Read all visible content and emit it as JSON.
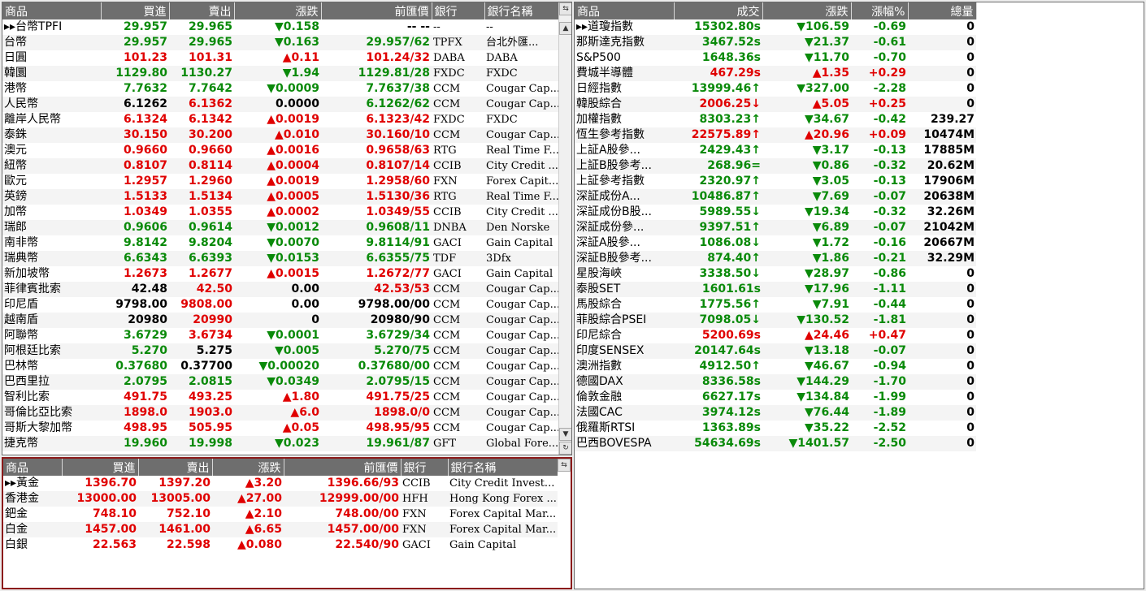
{
  "fx": {
    "headers": [
      "商品",
      "買進",
      "賣出",
      "漲跌",
      "前匯價",
      "銀行",
      "銀行名稱"
    ],
    "rows": [
      [
        "▸▸台幣TPFI",
        "29.957",
        "29.965",
        "▼0.158",
        "-- --",
        "--",
        "--",
        "g",
        "g",
        "g",
        "k"
      ],
      [
        "台幣",
        "29.957",
        "29.965",
        "▼0.163",
        "29.957/62",
        "TPFX",
        "台北外匯...",
        "g",
        "g",
        "g",
        "g"
      ],
      [
        "日圓",
        "101.23",
        "101.31",
        "▲0.11",
        "101.24/32",
        "DABA",
        "DABA",
        "rd",
        "rd",
        "rd",
        "rd"
      ],
      [
        "韓圜",
        "1129.80",
        "1130.27",
        "▼1.94",
        "1129.81/28",
        "FXDC",
        "FXDC",
        "g",
        "g",
        "g",
        "g"
      ],
      [
        "港幣",
        "7.7632",
        "7.7642",
        "▼0.0009",
        "7.7637/38",
        "CCM",
        "Cougar Cap...",
        "g",
        "g",
        "g",
        "g"
      ],
      [
        "人民幣",
        "6.1262",
        "6.1362",
        "0.0000",
        "6.1262/62",
        "CCM",
        "Cougar Cap...",
        "k",
        "rd",
        "k",
        "g"
      ],
      [
        "離岸人民幣",
        "6.1324",
        "6.1342",
        "▲0.0019",
        "6.1323/42",
        "FXDC",
        "FXDC",
        "rd",
        "rd",
        "rd",
        "rd"
      ],
      [
        "泰銖",
        "30.150",
        "30.200",
        "▲0.010",
        "30.160/10",
        "CCM",
        "Cougar Cap...",
        "rd",
        "rd",
        "rd",
        "rd"
      ],
      [
        "澳元",
        "0.9660",
        "0.9660",
        "▲0.0016",
        "0.9658/63",
        "RTG",
        "Real Time F...",
        "rd",
        "rd",
        "rd",
        "rd"
      ],
      [
        "紐幣",
        "0.8107",
        "0.8114",
        "▲0.0004",
        "0.8107/14",
        "CCIB",
        "City Credit ...",
        "rd",
        "rd",
        "rd",
        "rd"
      ],
      [
        "歐元",
        "1.2957",
        "1.2960",
        "▲0.0019",
        "1.2958/60",
        "FXN",
        "Forex Capit...",
        "rd",
        "rd",
        "rd",
        "rd"
      ],
      [
        "英鎊",
        "1.5133",
        "1.5134",
        "▲0.0005",
        "1.5130/36",
        "RTG",
        "Real Time F...",
        "rd",
        "rd",
        "rd",
        "rd"
      ],
      [
        "加幣",
        "1.0349",
        "1.0355",
        "▲0.0002",
        "1.0349/55",
        "CCIB",
        "City Credit ...",
        "rd",
        "rd",
        "rd",
        "rd"
      ],
      [
        "瑞郎",
        "0.9606",
        "0.9614",
        "▼0.0012",
        "0.9608/11",
        "DNBA",
        "Den Norske",
        "g",
        "g",
        "g",
        "g"
      ],
      [
        "南非幣",
        "9.8142",
        "9.8204",
        "▼0.0070",
        "9.8114/91",
        "GACI",
        "Gain Capital",
        "g",
        "g",
        "g",
        "g"
      ],
      [
        "瑞典幣",
        "6.6343",
        "6.6393",
        "▼0.0153",
        "6.6355/75",
        "TDF",
        "3Dfx",
        "g",
        "g",
        "g",
        "g"
      ],
      [
        "新加坡幣",
        "1.2673",
        "1.2677",
        "▲0.0015",
        "1.2672/77",
        "GACI",
        "Gain Capital",
        "rd",
        "rd",
        "rd",
        "rd"
      ],
      [
        "菲律賓批索",
        "42.48",
        "42.50",
        "0.00",
        "42.53/53",
        "CCM",
        "Cougar Cap...",
        "k",
        "rd",
        "k",
        "rd"
      ],
      [
        "印尼盾",
        "9798.00",
        "9808.00",
        "0.00",
        "9798.00/00",
        "CCM",
        "Cougar Cap...",
        "k",
        "rd",
        "k",
        "k"
      ],
      [
        "越南盾",
        "20980",
        "20990",
        "0",
        "20980/90",
        "CCM",
        "Cougar Cap...",
        "k",
        "rd",
        "k",
        "k"
      ],
      [
        "阿聯幣",
        "3.6729",
        "3.6734",
        "▼0.0001",
        "3.6729/34",
        "CCM",
        "Cougar Cap...",
        "g",
        "rd",
        "g",
        "g"
      ],
      [
        "阿根廷比索",
        "5.270",
        "5.275",
        "▼0.005",
        "5.270/75",
        "CCM",
        "Cougar Cap...",
        "g",
        "k",
        "g",
        "g"
      ],
      [
        "巴林幣",
        "0.37680",
        "0.37700",
        "▼0.00020",
        "0.37680/00",
        "CCM",
        "Cougar Cap...",
        "g",
        "k",
        "g",
        "g"
      ],
      [
        "巴西里拉",
        "2.0795",
        "2.0815",
        "▼0.0349",
        "2.0795/15",
        "CCM",
        "Cougar Cap...",
        "g",
        "g",
        "g",
        "g"
      ],
      [
        "智利比索",
        "491.75",
        "493.25",
        "▲1.80",
        "491.75/25",
        "CCM",
        "Cougar Cap...",
        "rd",
        "rd",
        "rd",
        "rd"
      ],
      [
        "哥倫比亞比索",
        "1898.0",
        "1903.0",
        "▲6.0",
        "1898.0/0",
        "CCM",
        "Cougar Cap...",
        "rd",
        "rd",
        "rd",
        "rd"
      ],
      [
        "哥斯大黎加幣",
        "498.95",
        "505.95",
        "▲0.05",
        "498.95/95",
        "CCM",
        "Cougar Cap...",
        "rd",
        "rd",
        "rd",
        "rd"
      ],
      [
        "捷克幣",
        "19.960",
        "19.998",
        "▼0.023",
        "19.961/87",
        "GFT",
        "Global Fore...",
        "g",
        "g",
        "g",
        "g"
      ]
    ]
  },
  "metals": {
    "headers": [
      "商品",
      "買進",
      "賣出",
      "漲跌",
      "前匯價",
      "銀行",
      "銀行名稱"
    ],
    "rows": [
      [
        "▸▸黃金",
        "1396.70",
        "1397.20",
        "▲3.20",
        "1396.66/93",
        "CCIB",
        "City Credit Invest...",
        "rd",
        "rd",
        "rd",
        "rd"
      ],
      [
        "香港金",
        "13000.00",
        "13005.00",
        "▲27.00",
        "12999.00/00",
        "HFH",
        "Hong Kong Forex ...",
        "rd",
        "rd",
        "rd",
        "rd"
      ],
      [
        "鈀金",
        "748.10",
        "752.10",
        "▲2.10",
        "748.00/00",
        "FXN",
        "Forex Capital Mar...",
        "rd",
        "rd",
        "rd",
        "rd"
      ],
      [
        "白金",
        "1457.00",
        "1461.00",
        "▲6.65",
        "1457.00/00",
        "FXN",
        "Forex Capital Mar...",
        "rd",
        "rd",
        "rd",
        "rd"
      ],
      [
        "白銀",
        "22.563",
        "22.598",
        "▲0.080",
        "22.540/90",
        "GACI",
        "Gain Capital",
        "rd",
        "rd",
        "rd",
        "rd"
      ]
    ]
  },
  "idx": {
    "headers": [
      "商品",
      "成交",
      "漲跌",
      "漲幅%",
      "總量"
    ],
    "rows": [
      [
        "▸▸道瓊指數",
        "15302.80s",
        "▼106.59",
        "-0.69",
        "0",
        "g",
        "g"
      ],
      [
        "那斯達克指數",
        "3467.52s",
        "▼21.37",
        "-0.61",
        "0",
        "g",
        "g"
      ],
      [
        "S&P500",
        "1648.36s",
        "▼11.70",
        "-0.70",
        "0",
        "g",
        "g"
      ],
      [
        "費城半導體",
        "467.29s",
        "▲1.35",
        "+0.29",
        "0",
        "rd",
        "rd"
      ],
      [
        "日經指數",
        "13999.46↑",
        "▼327.00",
        "-2.28",
        "0",
        "g",
        "g"
      ],
      [
        "韓股綜合",
        "2006.25↓",
        "▲5.05",
        "+0.25",
        "0",
        "rd",
        "rd"
      ],
      [
        "加權指數",
        "8303.23↑",
        "▼34.67",
        "-0.42",
        "239.27",
        "g",
        "g"
      ],
      [
        "恆生參考指數",
        "22575.89↑",
        "▲20.96",
        "+0.09",
        "10474M",
        "rd",
        "rd"
      ],
      [
        "上証A股參...",
        "2429.43↑",
        "▼3.17",
        "-0.13",
        "17885M",
        "g",
        "g"
      ],
      [
        "上証B股參考...",
        "268.96=",
        "▼0.86",
        "-0.32",
        "20.62M",
        "g",
        "g"
      ],
      [
        "上証參考指數",
        "2320.97↑",
        "▼3.05",
        "-0.13",
        "17906M",
        "g",
        "g"
      ],
      [
        "深証成份A...",
        "10486.87↑",
        "▼7.69",
        "-0.07",
        "20638M",
        "g",
        "g"
      ],
      [
        "深証成份B股...",
        "5989.55↓",
        "▼19.34",
        "-0.32",
        "32.26M",
        "g",
        "g"
      ],
      [
        "深証成份參...",
        "9397.51↑",
        "▼6.89",
        "-0.07",
        "21042M",
        "g",
        "g"
      ],
      [
        "深証A股參...",
        "1086.08↓",
        "▼1.72",
        "-0.16",
        "20667M",
        "g",
        "g"
      ],
      [
        "深証B股參考...",
        "874.40↑",
        "▼1.86",
        "-0.21",
        "32.29M",
        "g",
        "g"
      ],
      [
        "星股海峽",
        "3338.50↓",
        "▼28.97",
        "-0.86",
        "0",
        "g",
        "g"
      ],
      [
        "泰股SET",
        "1601.61s",
        "▼17.96",
        "-1.11",
        "0",
        "g",
        "g"
      ],
      [
        "馬股綜合",
        "1775.56↑",
        "▼7.91",
        "-0.44",
        "0",
        "g",
        "g"
      ],
      [
        "菲股綜合PSEI",
        "7098.05↓",
        "▼130.52",
        "-1.81",
        "0",
        "g",
        "g"
      ],
      [
        "印尼綜合",
        "5200.69s",
        "▲24.46",
        "+0.47",
        "0",
        "rd",
        "rd"
      ],
      [
        "印度SENSEX",
        "20147.64s",
        "▼13.18",
        "-0.07",
        "0",
        "g",
        "g"
      ],
      [
        "澳洲指數",
        "4912.50↑",
        "▼46.67",
        "-0.94",
        "0",
        "g",
        "g"
      ],
      [
        "德國DAX",
        "8336.58s",
        "▼144.29",
        "-1.70",
        "0",
        "g",
        "g"
      ],
      [
        "倫敦金融",
        "6627.17s",
        "▼134.84",
        "-1.99",
        "0",
        "g",
        "g"
      ],
      [
        "法國CAC",
        "3974.12s",
        "▼76.44",
        "-1.89",
        "0",
        "g",
        "g"
      ],
      [
        "俄羅斯RTSI",
        "1363.89s",
        "▼35.22",
        "-2.52",
        "0",
        "g",
        "g"
      ],
      [
        "巴西BOVESPA",
        "54634.69s",
        "▼1401.57",
        "-2.50",
        "0",
        "g",
        "g"
      ]
    ]
  }
}
